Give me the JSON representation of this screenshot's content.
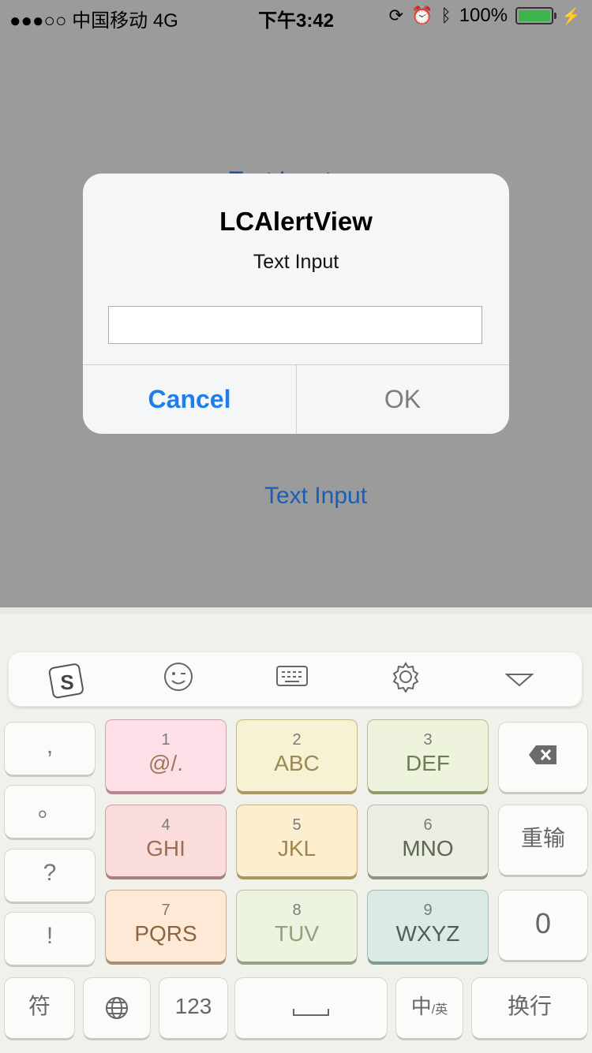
{
  "status_bar": {
    "carrier": "●●●○○ 中国移动  4G",
    "time": "下午3:42",
    "battery": "100%",
    "icons": [
      "orientation-lock-icon",
      "alarm-icon",
      "bluetooth-icon",
      "battery-icon",
      "charging-icon"
    ]
  },
  "background": {
    "text_input_button": "Text Input"
  },
  "alert": {
    "title": "LCAlertView",
    "message": "Text Input",
    "input_value": "",
    "cancel_label": "Cancel",
    "ok_label": "OK"
  },
  "keyboard": {
    "toolbar": [
      "sogou-logo-icon",
      "emoji-icon",
      "keyboard-icon",
      "settings-icon",
      "collapse-icon"
    ],
    "left_keys": [
      ",",
      "。",
      "?",
      "!"
    ],
    "number_keys": [
      {
        "num": "1",
        "letters": "@/."
      },
      {
        "num": "2",
        "letters": "ABC"
      },
      {
        "num": "3",
        "letters": "DEF"
      },
      {
        "num": "4",
        "letters": "GHI"
      },
      {
        "num": "5",
        "letters": "JKL"
      },
      {
        "num": "6",
        "letters": "MNO"
      },
      {
        "num": "7",
        "letters": "PQRS"
      },
      {
        "num": "8",
        "letters": "TUV"
      },
      {
        "num": "9",
        "letters": "WXYZ"
      }
    ],
    "right_keys": {
      "delete": "⌫",
      "reenter": "重输",
      "zero": "0"
    },
    "bottom": {
      "symbols": "符",
      "globe": "🌐",
      "numbers": "123",
      "space": "␣",
      "lang_main": "中",
      "lang_sub": "/英",
      "enter": "换行"
    }
  }
}
